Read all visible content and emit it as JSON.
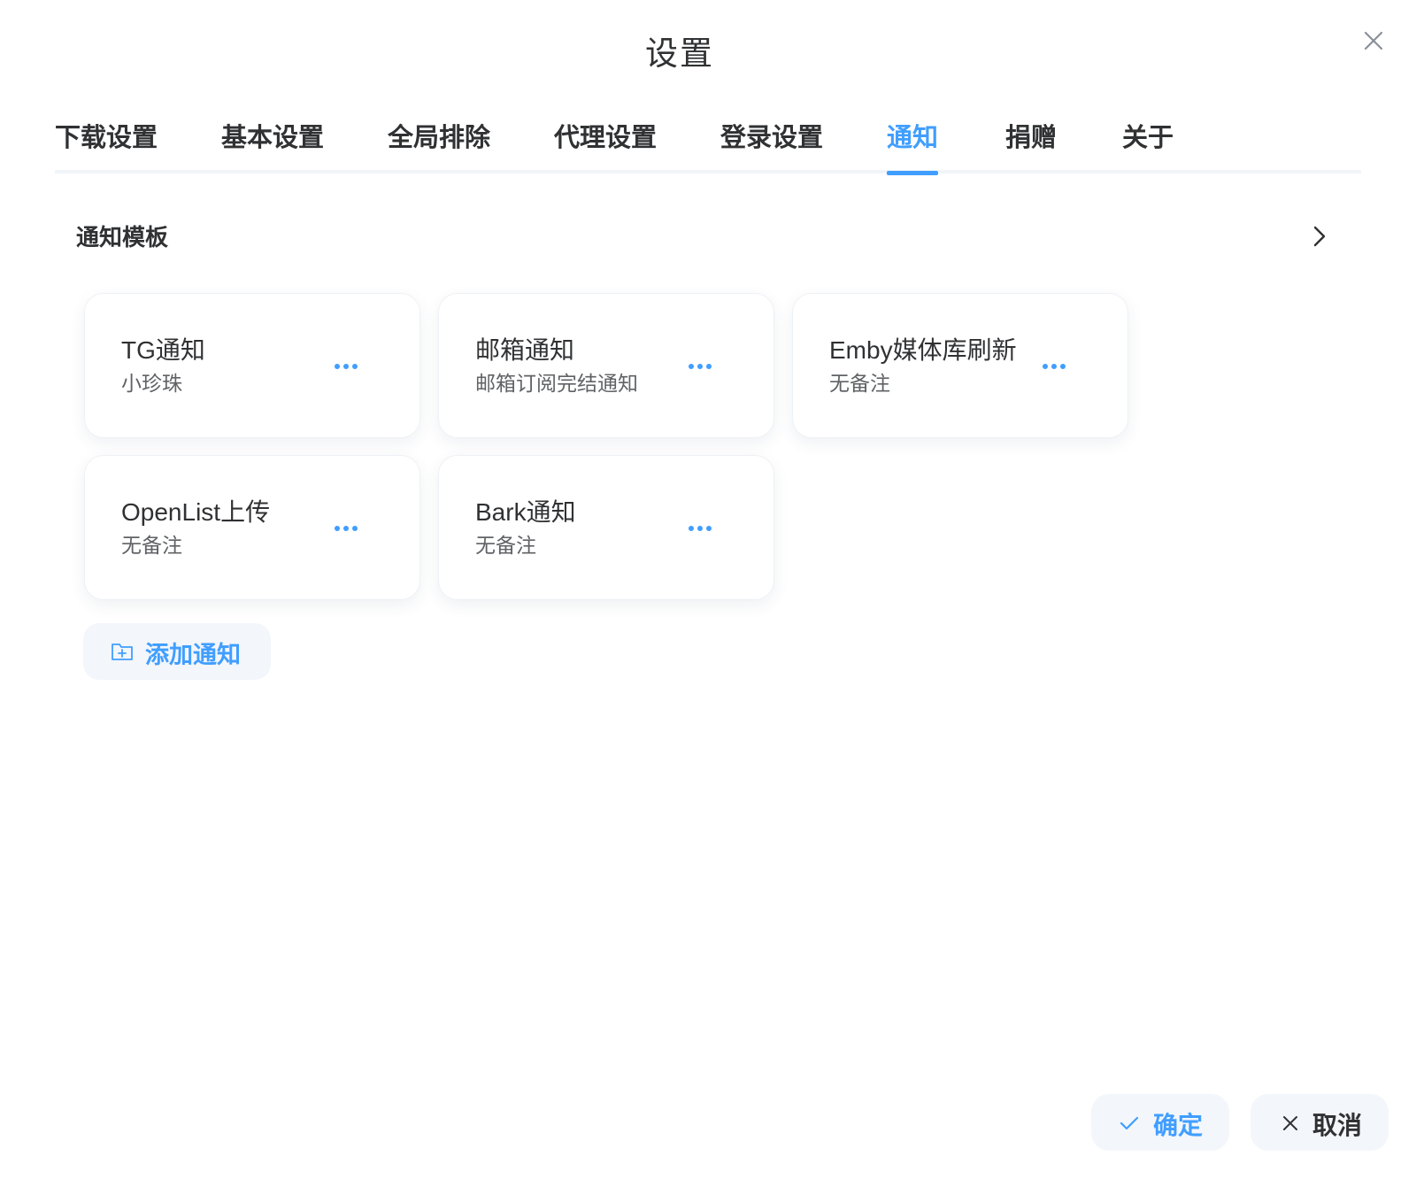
{
  "dialog": {
    "title": "设置",
    "close_icon": "close-icon"
  },
  "tabs": [
    {
      "label": "下载设置",
      "active": false
    },
    {
      "label": "基本设置",
      "active": false
    },
    {
      "label": "全局排除",
      "active": false
    },
    {
      "label": "代理设置",
      "active": false
    },
    {
      "label": "登录设置",
      "active": false
    },
    {
      "label": "通知",
      "active": true
    },
    {
      "label": "捐赠",
      "active": false
    },
    {
      "label": "关于",
      "active": false
    }
  ],
  "section": {
    "title": "通知模板",
    "icon": "chevron-right-icon"
  },
  "cards": [
    {
      "title": "TG通知",
      "subtitle": "小珍珠",
      "more_icon": "more-icon"
    },
    {
      "title": "邮箱通知",
      "subtitle": "邮箱订阅完结通知",
      "more_icon": "more-icon"
    },
    {
      "title": "Emby媒体库刷新",
      "subtitle": "无备注",
      "more_icon": "more-icon"
    },
    {
      "title": "OpenList上传",
      "subtitle": "无备注",
      "more_icon": "more-icon"
    },
    {
      "title": "Bark通知",
      "subtitle": "无备注",
      "more_icon": "more-icon"
    }
  ],
  "add_button": {
    "label": "添加通知",
    "icon": "folder-add-icon"
  },
  "footer": {
    "confirm_label": "确定",
    "confirm_icon": "check-icon",
    "cancel_label": "取消",
    "cancel_icon": "close-icon"
  },
  "colors": {
    "accent": "#409eff",
    "text": "#303133",
    "subtext": "#606266",
    "button_bg": "#f3f6fa"
  }
}
